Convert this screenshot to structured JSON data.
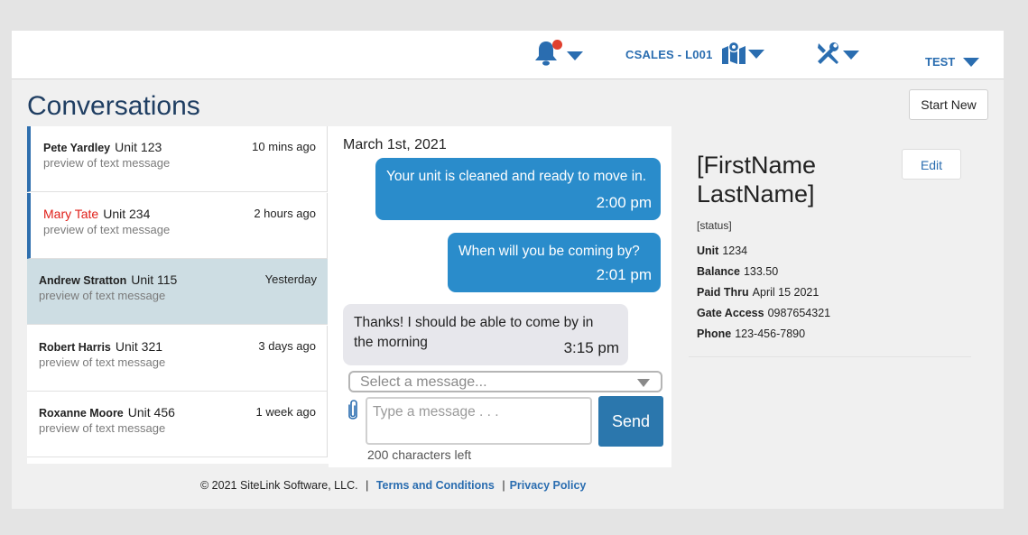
{
  "header": {
    "location_label": "CSALES - L001",
    "user_label": "TEST",
    "notification_dot_color": "#e0402f",
    "accent_color": "#2a6db0"
  },
  "page": {
    "title": "Conversations",
    "start_new_label": "Start New"
  },
  "conversations": [
    {
      "name": "Pete Yardley",
      "unit": "Unit 123",
      "preview": "preview of text message",
      "time": "10 mins ago",
      "unread": true,
      "active": false,
      "name_red": false
    },
    {
      "name": "Mary Tate",
      "unit": "Unit 234",
      "preview": "preview of text message",
      "time": "2 hours ago",
      "unread": true,
      "active": false,
      "name_red": true
    },
    {
      "name": "Andrew Stratton",
      "unit": "Unit 115",
      "preview": "preview of text message",
      "time": "Yesterday",
      "unread": false,
      "active": true,
      "name_red": false
    },
    {
      "name": "Robert Harris",
      "unit": "Unit 321",
      "preview": "preview of text message",
      "time": "3 days ago",
      "unread": false,
      "active": false,
      "name_red": false
    },
    {
      "name": "Roxanne Moore",
      "unit": "Unit 456",
      "preview": "preview of text message",
      "time": "1 week ago",
      "unread": false,
      "active": false,
      "name_red": false
    }
  ],
  "thread": {
    "date": "March 1st, 2021",
    "messages": [
      {
        "text": "Your unit is cleaned and ready to move in.",
        "time": "2:00 pm",
        "direction": "out"
      },
      {
        "text": "When will you be coming by?",
        "time": "2:01 pm",
        "direction": "out"
      },
      {
        "text": "Thanks! I should be able to come by in the morning",
        "time": "3:15 pm",
        "direction": "in"
      }
    ],
    "select_placeholder": "Select a message...",
    "input_placeholder": "Type a message . . .",
    "send_label": "Send",
    "chars_left": "200 characters left"
  },
  "contact": {
    "name_line1": "[FirstName",
    "name_line2": "LastName]",
    "edit_label": "Edit",
    "status": "[status]",
    "details": [
      {
        "label": "Unit",
        "value": "1234"
      },
      {
        "label": "Balance",
        "value": "133.50"
      },
      {
        "label": "Paid Thru",
        "value": "April 15 2021"
      },
      {
        "label": "Gate Access",
        "value": "0987654321"
      },
      {
        "label": "Phone",
        "value": "123-456-7890"
      }
    ]
  },
  "footer": {
    "copyright": "© 2021 SiteLink Software, LLC.",
    "separator": "|",
    "terms_label": "Terms and Conditions",
    "privacy_label": "Privacy Policy"
  }
}
